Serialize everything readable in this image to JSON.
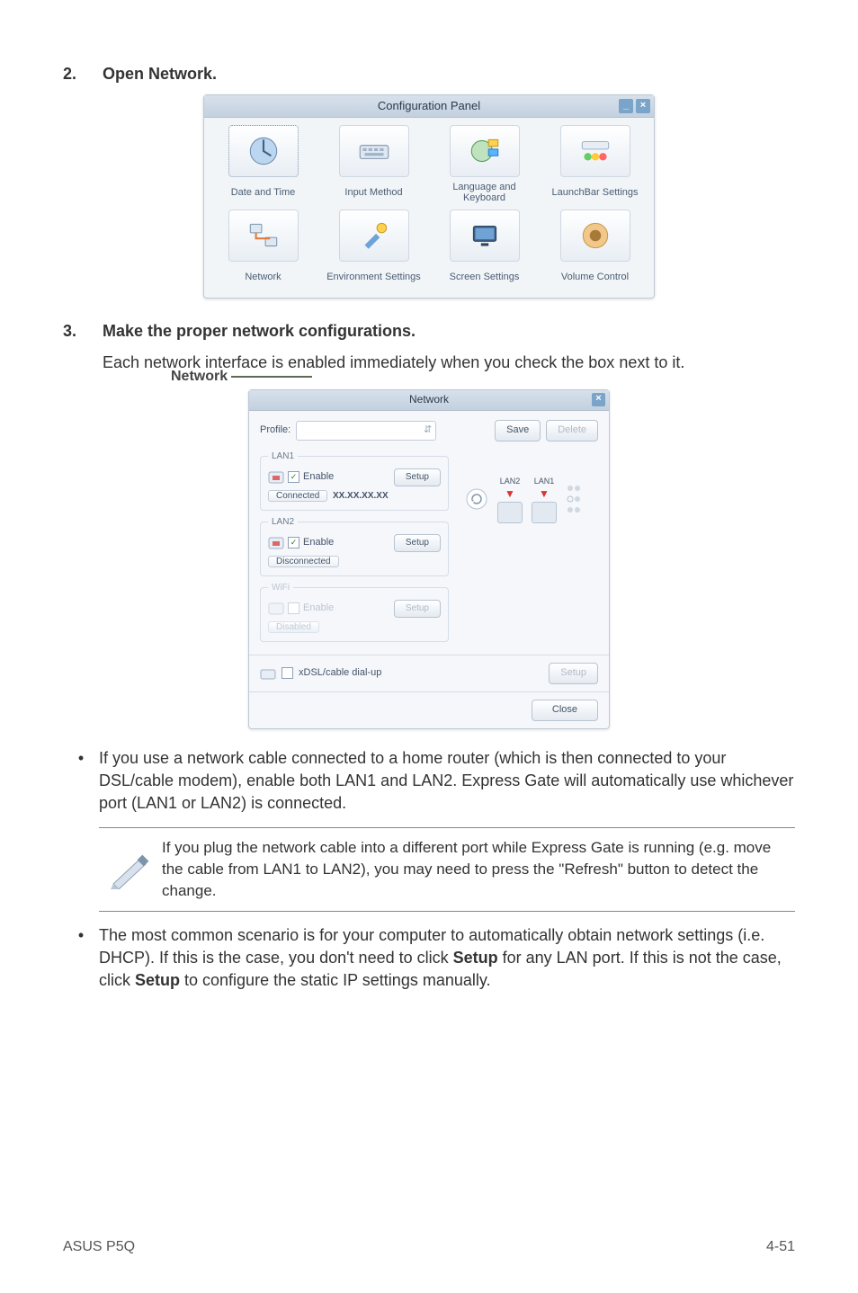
{
  "steps": {
    "step2_num": "2.",
    "step2_text": "Open Network.",
    "step3_num": "3.",
    "step3_text": "Make the proper network configurations.",
    "step3_body": "Each network interface is enabled immediately when you check the box next to it."
  },
  "net_label": "Network",
  "config_panel": {
    "title": "Configuration Panel",
    "items": [
      {
        "label": "Date and Time",
        "name": "date-and-time"
      },
      {
        "label": "Input Method",
        "name": "input-method"
      },
      {
        "label": "Language and Keyboard",
        "name": "language-and-keyboard"
      },
      {
        "label": "LaunchBar Settings",
        "name": "launchbar-settings"
      },
      {
        "label": "Network",
        "name": "network"
      },
      {
        "label": "Environment Settings",
        "name": "environment-settings"
      },
      {
        "label": "Screen Settings",
        "name": "screen-settings"
      },
      {
        "label": "Volume Control",
        "name": "volume-control"
      }
    ]
  },
  "network_dialog": {
    "title": "Network",
    "profile_label": "Profile:",
    "save_btn": "Save",
    "delete_btn": "Delete",
    "lan1": {
      "legend": "LAN1",
      "enable": "Enable",
      "setup": "Setup",
      "status": "Connected",
      "ip": "XX.XX.XX.XX"
    },
    "lan2": {
      "legend": "LAN2",
      "enable": "Enable",
      "setup": "Setup",
      "status": "Disconnected"
    },
    "wifi": {
      "legend": "WiFi",
      "enable": "Enable",
      "setup": "Setup",
      "status": "Disabled"
    },
    "diagram": {
      "port1": "LAN2",
      "port2": "LAN1"
    },
    "xdsl": {
      "label": "xDSL/cable dial-up",
      "setup": "Setup"
    },
    "close": "Close"
  },
  "bullets": {
    "b1": "If you use a network cable connected to a home router (which is then connected to your DSL/cable modem), enable both LAN1 and LAN2. Express Gate  will automatically use whichever port (LAN1 or LAN2) is connected.",
    "b2_pre": "The most common scenario is for your computer to automatically obtain network settings (i.e. DHCP). If this is the case, you don't need to click ",
    "b2_bold1": "Setup",
    "b2_mid": " for any LAN port. If this is not the case, click ",
    "b2_bold2": "Setup",
    "b2_post": " to configure the static IP settings manually."
  },
  "note": "If you plug the network cable into a different port while Express Gate  is running (e.g. move the cable from LAN1 to LAN2), you may need to press the \"Refresh\" button to detect the change.",
  "footer": {
    "left": "ASUS P5Q",
    "right": "4-51"
  }
}
